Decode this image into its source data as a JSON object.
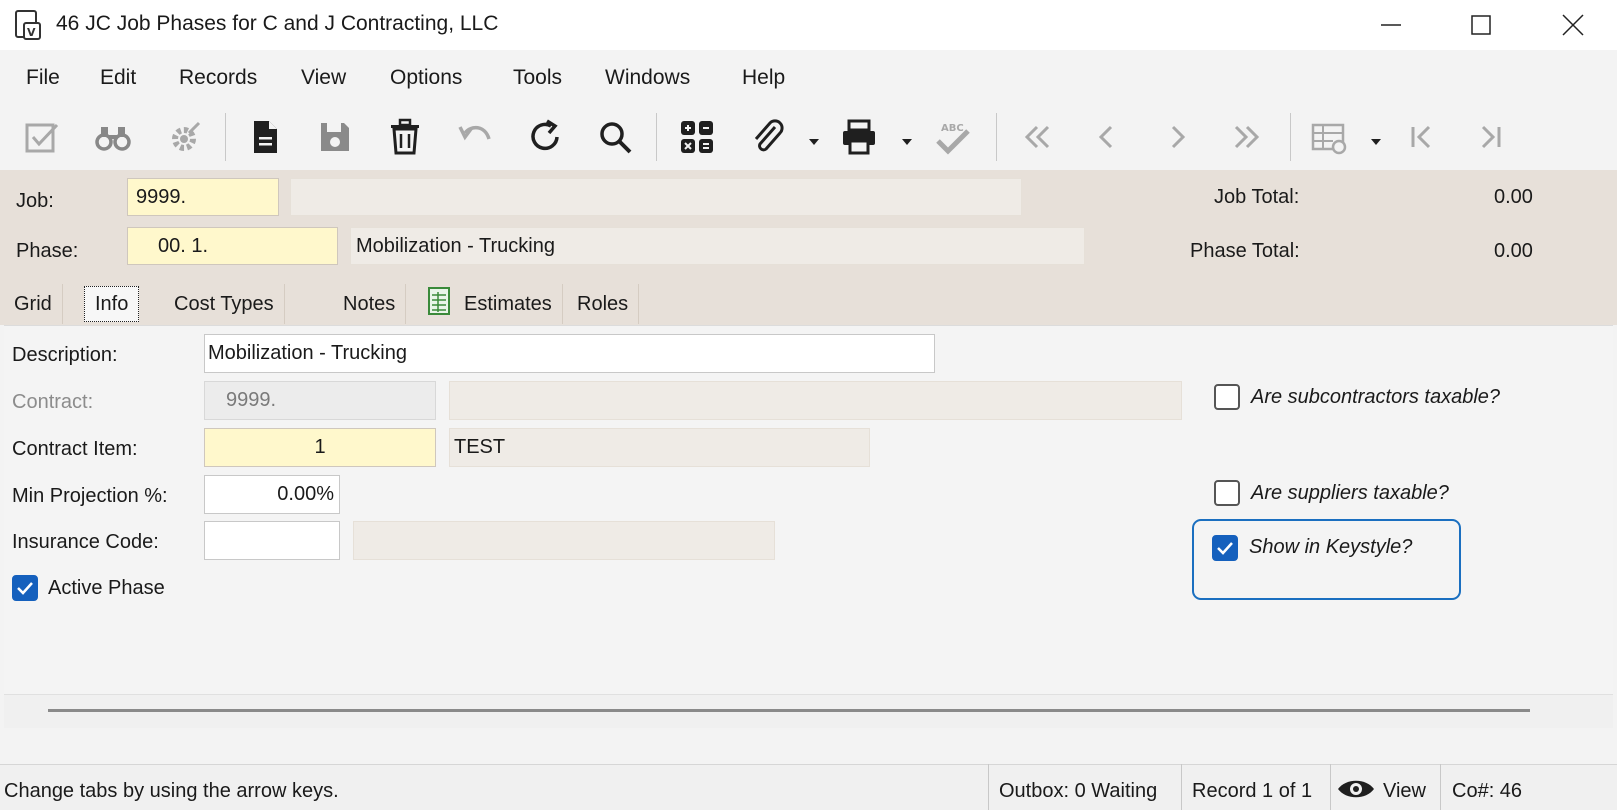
{
  "window": {
    "title": "46 JC Job Phases for C and J Contracting, LLC",
    "minimize_icon": "minimize-icon",
    "maximize_icon": "maximize-icon",
    "close_icon": "close-icon"
  },
  "menu": {
    "items": [
      "File",
      "Edit",
      "Records",
      "View",
      "Options",
      "Tools",
      "Windows",
      "Help"
    ]
  },
  "toolbar": {
    "icons": [
      "edit-check-icon",
      "binoculars-icon",
      "settings-gear-icon",
      "new-document-icon",
      "save-icon",
      "delete-icon",
      "undo-icon",
      "refresh-icon",
      "search-icon",
      "calculator-icon",
      "attach-icon",
      "print-icon",
      "spellcheck-icon",
      "first-record-icon",
      "previous-record-icon",
      "next-record-icon",
      "last-record-icon",
      "grid-settings-icon",
      "first-page-icon",
      "last-page-icon"
    ]
  },
  "header": {
    "job_label": "Job:",
    "job_value": "9999.",
    "job_desc": "",
    "phase_label": "Phase:",
    "phase_value": "00.  1.",
    "phase_desc": "Mobilization - Trucking",
    "job_total_label": "Job Total:",
    "job_total_value": "0.00",
    "phase_total_label": "Phase Total:",
    "phase_total_value": "0.00"
  },
  "tabs": {
    "grid": "Grid",
    "info": "Info",
    "cost_types": "Cost Types",
    "notes": "Notes",
    "estimates": "Estimates",
    "roles": "Roles",
    "active": "Info"
  },
  "form": {
    "description_label": "Description:",
    "description_value": "Mobilization - Trucking",
    "contract_label": "Contract:",
    "contract_value": "9999.",
    "contract_desc": "",
    "contract_item_label": "Contract Item:",
    "contract_item_value": "1",
    "contract_item_desc": "TEST",
    "min_projection_label": "Min Projection %:",
    "min_projection_value": "0.00%",
    "insurance_code_label": "Insurance Code:",
    "insurance_code_value": "",
    "insurance_desc": "",
    "active_phase_label": "Active Phase",
    "active_phase_checked": true,
    "subcontractors_taxable_label": "Are subcontractors taxable?",
    "subcontractors_taxable_checked": false,
    "suppliers_taxable_label": "Are suppliers taxable?",
    "suppliers_taxable_checked": false,
    "show_keystyle_label": "Show in Keystyle?",
    "show_keystyle_checked": true
  },
  "status": {
    "hint": "Change tabs by using the arrow keys.",
    "outbox": "Outbox: 0 Waiting",
    "record": "Record 1 of 1",
    "mode": "View",
    "company": "Co#: 46"
  },
  "colors": {
    "header_bg": "#e7e0d9",
    "required_field": "#fff8cc",
    "checkbox_checked": "#1560bd",
    "focus_outline": "#1a6fc0"
  }
}
